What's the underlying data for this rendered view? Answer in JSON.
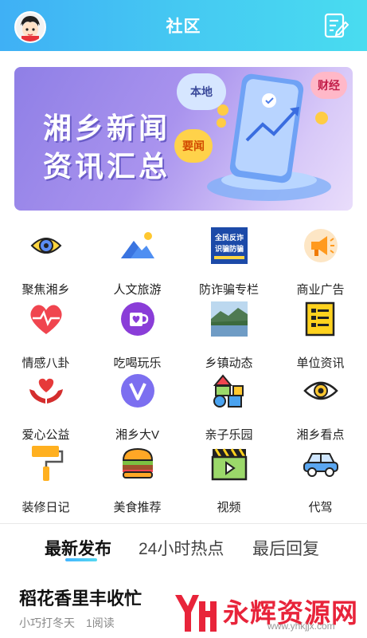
{
  "header": {
    "title": "社区"
  },
  "banner": {
    "line1": "湘乡新闻",
    "line2": "资讯汇总",
    "tag_local": "本地",
    "tag_finance": "财经",
    "tag_important": "要闻"
  },
  "grid": [
    {
      "label": "聚焦湘乡",
      "icon": "eye-icon"
    },
    {
      "label": "人文旅游",
      "icon": "mountain-icon"
    },
    {
      "label": "防诈骗专栏",
      "icon": "anti-fraud-poster-icon",
      "poster_text": "全民反诈 识骗防骗"
    },
    {
      "label": "商业广告",
      "icon": "megaphone-icon"
    },
    {
      "label": "情感八卦",
      "icon": "heart-pulse-icon"
    },
    {
      "label": "吃喝玩乐",
      "icon": "cup-heart-icon"
    },
    {
      "label": "乡镇动态",
      "icon": "landscape-photo-icon"
    },
    {
      "label": "单位资讯",
      "icon": "document-list-icon"
    },
    {
      "label": "爱心公益",
      "icon": "hands-heart-icon"
    },
    {
      "label": "湘乡大V",
      "icon": "v-badge-icon"
    },
    {
      "label": "亲子乐园",
      "icon": "blocks-icon"
    },
    {
      "label": "湘乡看点",
      "icon": "eye-outline-icon"
    },
    {
      "label": "装修日记",
      "icon": "paint-roller-icon"
    },
    {
      "label": "美食推荐",
      "icon": "burger-icon"
    },
    {
      "label": "视频",
      "icon": "video-clapper-icon"
    },
    {
      "label": "代驾",
      "icon": "car-icon"
    }
  ],
  "tabs": [
    "最新发布",
    "24小时热点",
    "最后回复"
  ],
  "post": {
    "title": "稻花香里丰收忙",
    "author": "小巧打冬天",
    "reads": "1阅读"
  },
  "watermark": {
    "name": "永辉资源网",
    "url": "www.yhkjjx.com"
  },
  "colors": {
    "header_start": "#3fb0f5",
    "header_end": "#49dcf0",
    "watermark": "#e8243a"
  }
}
